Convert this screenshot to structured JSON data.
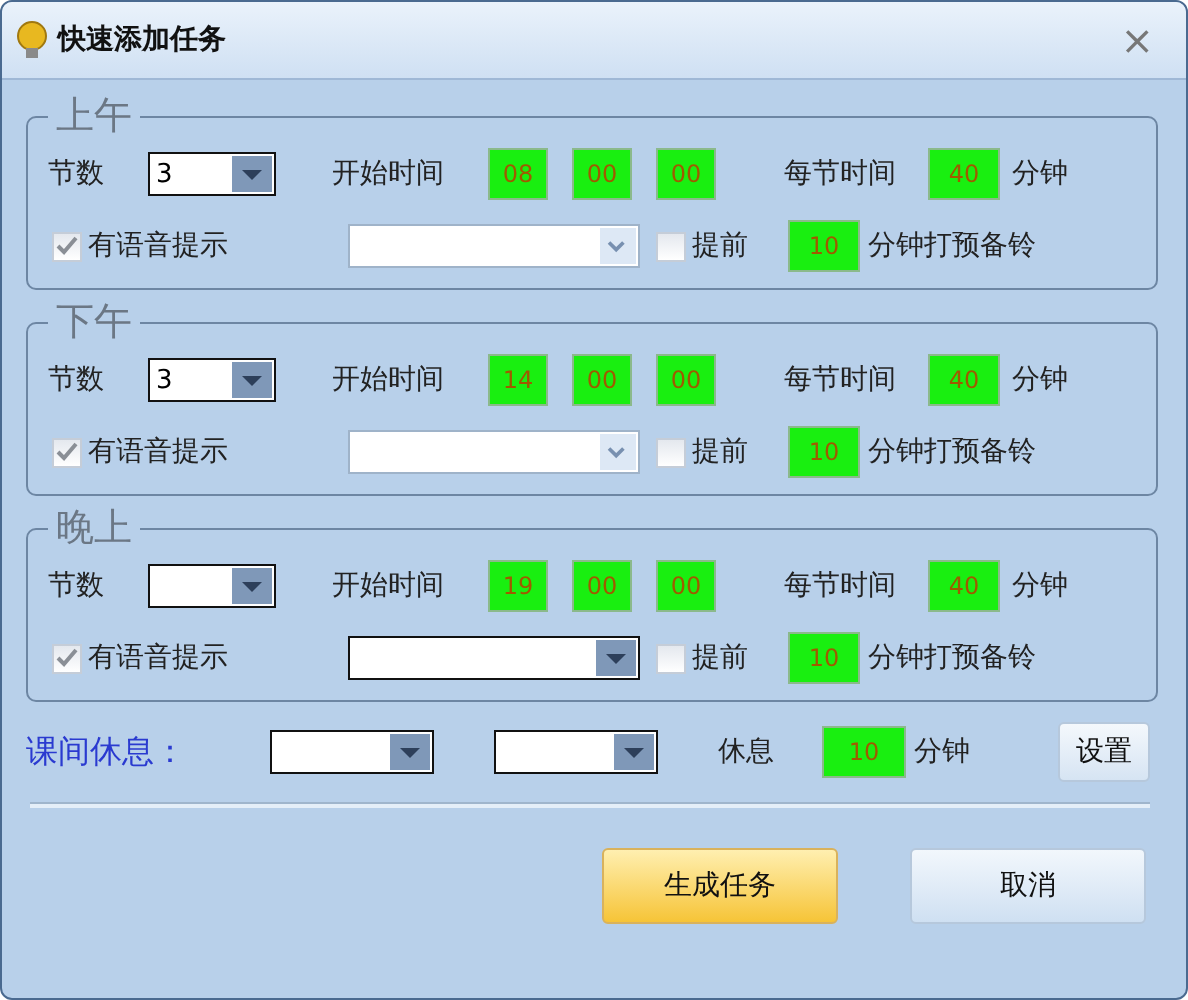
{
  "window": {
    "title": "快速添加任务",
    "close": "×"
  },
  "sections": [
    {
      "title": "上午",
      "count_label": "节数",
      "count_value": "3",
      "start_label": "开始时间",
      "start": [
        "08",
        "00",
        "00"
      ],
      "period_label": "每节时间",
      "period": "40",
      "period_unit": "分钟",
      "voice_label": "有语音提示",
      "voice_checked": true,
      "sound_disabled": true,
      "advance_label": "提前",
      "advance_checked": false,
      "advance": "10",
      "advance_unit": "分钟打预备铃"
    },
    {
      "title": "下午",
      "count_label": "节数",
      "count_value": "3",
      "start_label": "开始时间",
      "start": [
        "14",
        "00",
        "00"
      ],
      "period_label": "每节时间",
      "period": "40",
      "period_unit": "分钟",
      "voice_label": "有语音提示",
      "voice_checked": true,
      "sound_disabled": true,
      "advance_label": "提前",
      "advance_checked": false,
      "advance": "10",
      "advance_unit": "分钟打预备铃"
    },
    {
      "title": "晚上",
      "count_label": "节数",
      "start_label": "开始时间",
      "start": [
        "19",
        "00",
        "00"
      ],
      "period_label": "每节时间",
      "period": "40",
      "period_unit": "分钟",
      "voice_label": "有语音提示",
      "voice_checked": true,
      "sound_disabled": false,
      "advance_label": "提前",
      "advance_checked": false,
      "advance": "10",
      "advance_unit": "分钟打预备铃"
    }
  ],
  "break": {
    "label": "课间休息：",
    "rest_label": "休息",
    "rest": "10",
    "rest_unit": "分钟",
    "settings_button": "设置"
  },
  "buttons": [
    {
      "label": "生成任务",
      "primary": true
    },
    {
      "label": "取消",
      "primary": false
    }
  ]
}
